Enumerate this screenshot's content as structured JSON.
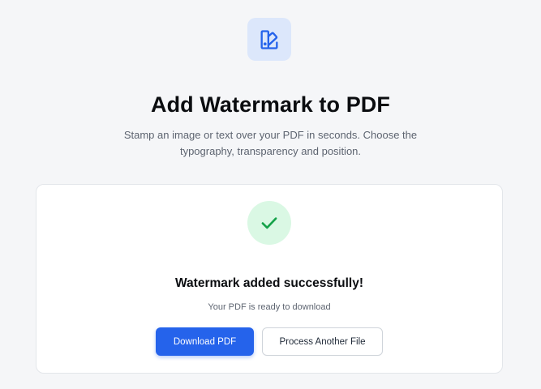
{
  "header": {
    "icon": "document-brush-icon",
    "title": "Add Watermark to PDF",
    "subtitle": "Stamp an image or text over your PDF in seconds. Choose the typography, transparency and position."
  },
  "result": {
    "icon": "checkmark-icon",
    "title": "Watermark added successfully!",
    "subtitle": "Your PDF is ready to download",
    "download_label": "Download PDF",
    "process_another_label": "Process Another File"
  },
  "colors": {
    "accent": "#2563eb",
    "icon_bg": "#dce7fb",
    "success": "#16a34a",
    "success_bg": "#daf8e4"
  }
}
